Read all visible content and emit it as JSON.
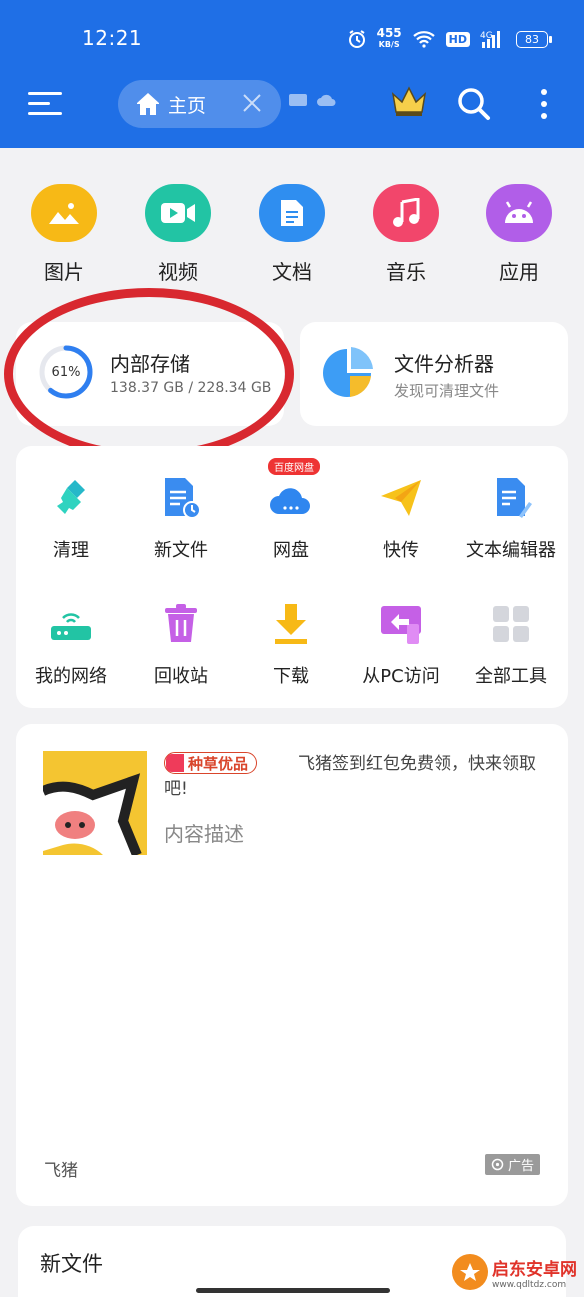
{
  "status_bar": {
    "time": "12:21",
    "net_speed": "455",
    "net_unit": "KB/S",
    "hd": "HD",
    "signal": "4G",
    "battery": "83"
  },
  "top_bar": {
    "tab_label": "主页"
  },
  "categories": [
    {
      "label": "图片",
      "icon": "image-icon",
      "color": "#f7b916"
    },
    {
      "label": "视频",
      "icon": "video-icon",
      "color": "#22c4a4"
    },
    {
      "label": "文档",
      "icon": "document-icon",
      "color": "#2f8ef0"
    },
    {
      "label": "音乐",
      "icon": "music-icon",
      "color": "#f2466b"
    },
    {
      "label": "应用",
      "icon": "android-icon",
      "color": "#b15ee8"
    }
  ],
  "storage": {
    "title": "内部存储",
    "percent_label": "61%",
    "percent": 61,
    "usage": "138.37 GB / 228.34 GB"
  },
  "analyzer": {
    "title": "文件分析器",
    "subtitle": "发现可清理文件"
  },
  "tools": [
    {
      "label": "清理",
      "icon": "broom-icon"
    },
    {
      "label": "新文件",
      "icon": "new-file-icon"
    },
    {
      "label": "网盘",
      "icon": "cloud-drive-icon",
      "badge": "百度网盘"
    },
    {
      "label": "快传",
      "icon": "paper-plane-icon"
    },
    {
      "label": "文本编辑器",
      "icon": "text-editor-icon"
    },
    {
      "label": "我的网络",
      "icon": "router-icon"
    },
    {
      "label": "回收站",
      "icon": "trash-icon"
    },
    {
      "label": "下载",
      "icon": "download-icon"
    },
    {
      "label": "从PC访问",
      "icon": "pc-access-icon"
    },
    {
      "label": "全部工具",
      "icon": "all-tools-icon"
    }
  ],
  "ad": {
    "tag": "种草优品",
    "text": "飞猪签到红包免费领，快来领取吧!",
    "desc": "内容描述",
    "brand": "飞猪",
    "ad_label": "广告"
  },
  "new_files": {
    "title": "新文件"
  },
  "watermark": {
    "main": "启东安卓网",
    "url": "www.qdltdz.com"
  }
}
